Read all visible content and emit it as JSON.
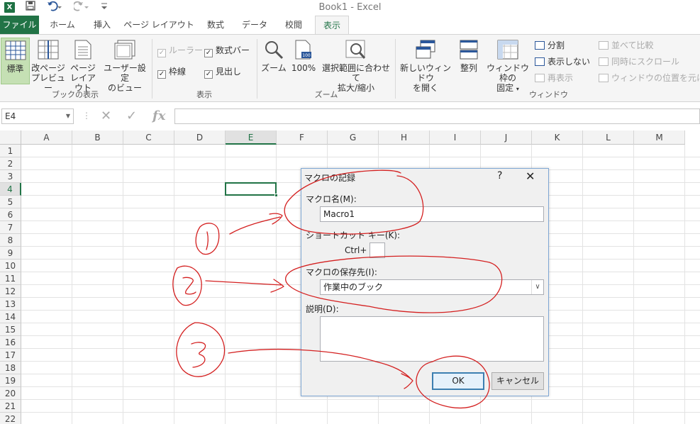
{
  "app": {
    "title": "Book1 - Excel",
    "logo_letter": "X"
  },
  "tabs": [
    "ファイル",
    "ホーム",
    "挿入",
    "ページ レイアウト",
    "数式",
    "データ",
    "校閲",
    "表示"
  ],
  "ribbon": {
    "workbook_views": {
      "label": "ブックの表示",
      "normal": "標準",
      "page_break_1": "改ページ",
      "page_break_2": "プレビュー",
      "page_layout_1": "ページ",
      "page_layout_2": "レイアウト",
      "custom_1": "ユーザー設定",
      "custom_2": "のビュー"
    },
    "show": {
      "label": "表示",
      "ruler": "ルーラー",
      "formula_bar": "数式バー",
      "gridlines": "枠線",
      "headings": "見出し",
      "check_mark": "✓"
    },
    "zoom": {
      "label": "ズーム",
      "zoom": "ズーム",
      "hundred": "100%",
      "hundred_icon_text": "100",
      "selection_1": "選択範囲に合わせて",
      "selection_2": "拡大/縮小"
    },
    "window": {
      "label": "ウィンドウ",
      "new_window_1": "新しいウィンドウ",
      "new_window_2": "を開く",
      "arrange": "整列",
      "freeze_1": "ウィンドウ枠の",
      "freeze_2": "固定",
      "split": "分割",
      "hide": "表示しない",
      "unhide": "再表示",
      "side_by_side": "並べて比較",
      "sync_scroll": "同時にスクロール",
      "reset_position": "ウィンドウの位置を元に戻す"
    }
  },
  "formula_bar": {
    "name_box": "E4",
    "fx": "fx",
    "value": ""
  },
  "sheet": {
    "columns": [
      "A",
      "B",
      "C",
      "D",
      "E",
      "F",
      "G",
      "H",
      "I",
      "J",
      "K",
      "L",
      "M"
    ],
    "rows": [
      "1",
      "2",
      "3",
      "4",
      "5",
      "6",
      "7",
      "8",
      "9",
      "10",
      "11",
      "12",
      "13",
      "14",
      "15",
      "16",
      "17",
      "18",
      "19",
      "20",
      "21",
      "22"
    ],
    "active_cell": "E4"
  },
  "dialog": {
    "title": "マクロの記録",
    "help": "?",
    "close": "✕",
    "macro_name_label": "マクロ名(M):",
    "macro_name_value": "Macro1",
    "shortcut_label": "ショートカット キー(K):",
    "ctrl_label": "Ctrl+",
    "store_label": "マクロの保存先(I):",
    "store_value": "作業中のブック",
    "description_label": "説明(D):",
    "ok": "OK",
    "cancel": "キャンセル"
  },
  "annotations": {
    "color": "#d42020"
  },
  "colors": {
    "excel_green": "#217346",
    "ribbon_bg": "#f5f5f5",
    "dialog_bg": "#f0f0f0"
  }
}
